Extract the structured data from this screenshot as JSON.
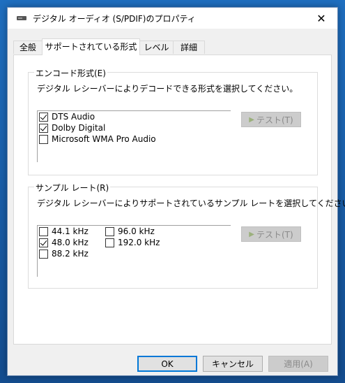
{
  "window": {
    "title": "デジタル オーディオ (S/PDIF)のプロパティ",
    "close_glyph": "✕"
  },
  "tabs": [
    {
      "label": "全般",
      "active": false
    },
    {
      "label": "サポートされている形式",
      "active": true
    },
    {
      "label": "レベル",
      "active": false
    },
    {
      "label": "詳細",
      "active": false
    }
  ],
  "encode_group": {
    "legend": "エンコード形式(E)",
    "description": "デジタル レシーバーによりデコードできる形式を選択してください。",
    "items": [
      {
        "label": "DTS Audio",
        "checked": true
      },
      {
        "label": "Dolby Digital",
        "checked": true
      },
      {
        "label": "Microsoft WMA Pro Audio",
        "checked": false
      }
    ],
    "test_label": "テスト(T)"
  },
  "sample_group": {
    "legend": "サンプル レート(R)",
    "description": "デジタル レシーバーによりサポートされているサンプル レートを選択してください。",
    "rates": [
      {
        "label": "44.1 kHz",
        "checked": false
      },
      {
        "label": "48.0 kHz",
        "checked": true
      },
      {
        "label": "88.2 kHz",
        "checked": false
      },
      {
        "label": "96.0 kHz",
        "checked": false
      },
      {
        "label": "192.0 kHz",
        "checked": false
      }
    ],
    "test_label": "テスト(T)"
  },
  "buttons": {
    "ok": "OK",
    "cancel": "キャンセル",
    "apply": "適用(A)"
  }
}
